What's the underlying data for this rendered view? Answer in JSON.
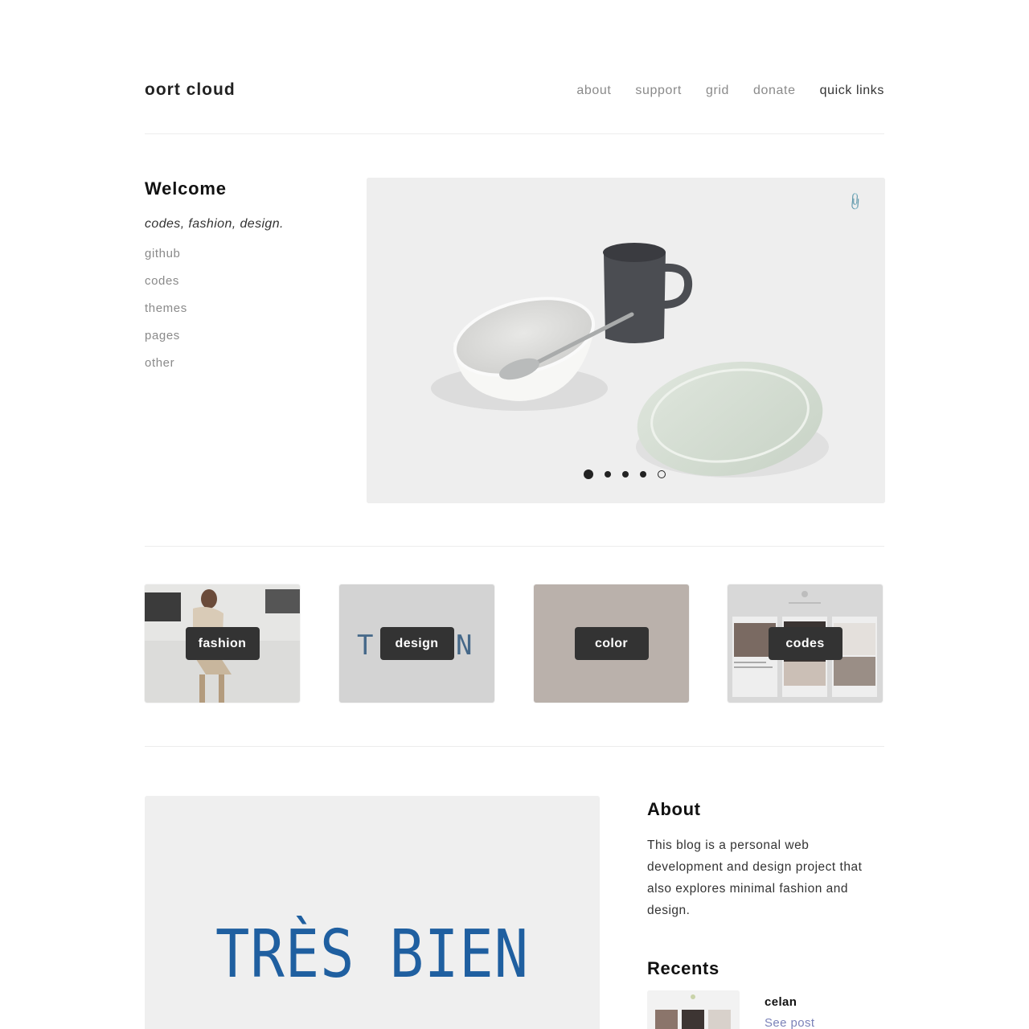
{
  "header": {
    "site_title": "oort cloud",
    "nav": [
      "about",
      "support",
      "grid",
      "donate",
      "quick links"
    ]
  },
  "welcome": {
    "title": "Welcome",
    "tagline": "codes, fashion, design.",
    "links": [
      "github",
      "codes",
      "themes",
      "pages",
      "other"
    ]
  },
  "hero": {
    "slide_count": 5,
    "active_slide": 1,
    "attachment_icon": "paperclip-icon"
  },
  "categories": [
    {
      "label": "fashion"
    },
    {
      "label": "design"
    },
    {
      "label": "color"
    },
    {
      "label": "codes"
    }
  ],
  "design_tile_letters": {
    "left": "T",
    "right": "N"
  },
  "post": {
    "image_text": "TRÈS BIEN"
  },
  "about": {
    "title": "About",
    "text": "This blog is a personal web development and design project that also explores minimal fashion and design."
  },
  "recents": {
    "title": "Recents",
    "items": [
      {
        "title": "celan",
        "link": "See post"
      }
    ]
  },
  "colors": {
    "accent_blue": "#1f5fa0",
    "link_purple": "#7b82b8",
    "label_bg": "#333333",
    "color_tile": "#bab1ab"
  }
}
